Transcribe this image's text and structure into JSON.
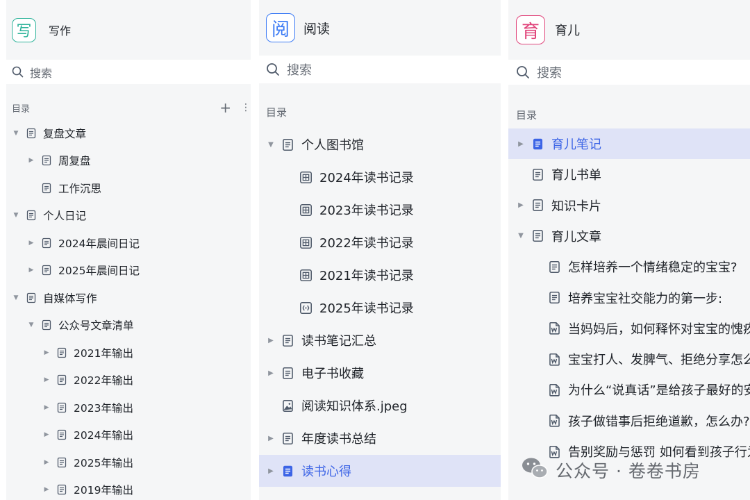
{
  "colors": {
    "panel_bg": "#f5f6f7",
    "active_bg": "#dfe3f7",
    "active_text": "#3c64e6",
    "write_accent": "#2eb39a",
    "read_accent": "#3c7bf5",
    "parent_accent": "#e0457b"
  },
  "panel1": {
    "icon_char": "写",
    "title": "写作",
    "search_label": "搜索",
    "toc_label": "目录",
    "add_glyph": "+",
    "items": [
      {
        "label": "复盘文章",
        "icon": "doc-icon",
        "arrow": "expanded"
      },
      {
        "label": "周复盘",
        "icon": "doc-icon",
        "arrow": "collapsed"
      },
      {
        "label": "工作沉思",
        "icon": "doc-icon",
        "arrow": "none"
      },
      {
        "label": "个人日记",
        "icon": "doc-icon",
        "arrow": "expanded"
      },
      {
        "label": "2024年晨间日记",
        "icon": "doc-icon",
        "arrow": "collapsed"
      },
      {
        "label": "2025年晨间日记",
        "icon": "doc-icon",
        "arrow": "collapsed"
      },
      {
        "label": "自媒体写作",
        "icon": "doc-icon",
        "arrow": "expanded"
      },
      {
        "label": "公众号文章清单",
        "icon": "doc-icon",
        "arrow": "expanded"
      },
      {
        "label": "2021年输出",
        "icon": "doc-icon",
        "arrow": "collapsed"
      },
      {
        "label": "2022年输出",
        "icon": "doc-icon",
        "arrow": "collapsed"
      },
      {
        "label": "2023年输出",
        "icon": "doc-icon",
        "arrow": "collapsed"
      },
      {
        "label": "2024年输出",
        "icon": "doc-icon",
        "arrow": "collapsed"
      },
      {
        "label": "2025年输出",
        "icon": "doc-icon",
        "arrow": "collapsed"
      },
      {
        "label": "2019年输出",
        "icon": "doc-icon",
        "arrow": "collapsed"
      }
    ]
  },
  "panel2": {
    "icon_char": "阅",
    "title": "阅读",
    "search_label": "搜索",
    "toc_label": "目录",
    "items": [
      {
        "label": "个人图书馆",
        "icon": "doc-icon",
        "arrow": "expanded"
      },
      {
        "label": "2024年读书记录",
        "icon": "table-icon",
        "arrow": "none"
      },
      {
        "label": "2023年读书记录",
        "icon": "table-icon",
        "arrow": "none"
      },
      {
        "label": "2022年读书记录",
        "icon": "table-icon",
        "arrow": "none"
      },
      {
        "label": "2021年读书记录",
        "icon": "table-icon",
        "arrow": "none"
      },
      {
        "label": "2025年读书记录",
        "icon": "embed-icon",
        "arrow": "none"
      },
      {
        "label": "读书笔记汇总",
        "icon": "doc-icon",
        "arrow": "collapsed"
      },
      {
        "label": "电子书收藏",
        "icon": "doc-icon",
        "arrow": "collapsed"
      },
      {
        "label": "阅读知识体系.jpeg",
        "icon": "image-icon",
        "arrow": "none"
      },
      {
        "label": "年度读书总结",
        "icon": "doc-icon",
        "arrow": "collapsed"
      },
      {
        "label": "读书心得",
        "icon": "doc-filled-icon",
        "arrow": "collapsed",
        "active": true
      }
    ]
  },
  "panel3": {
    "icon_char": "育",
    "title": "育儿",
    "search_label": "搜索",
    "toc_label": "目录",
    "items": [
      {
        "label": "育儿笔记",
        "icon": "doc-filled-icon",
        "arrow": "collapsed",
        "active": true
      },
      {
        "label": "育儿书单",
        "icon": "doc-icon",
        "arrow": "none"
      },
      {
        "label": "知识卡片",
        "icon": "doc-icon",
        "arrow": "collapsed"
      },
      {
        "label": "育儿文章",
        "icon": "doc-icon",
        "arrow": "expanded"
      },
      {
        "label": "怎样培养一个情绪稳定的宝宝?",
        "icon": "doc-icon",
        "arrow": "none"
      },
      {
        "label": "培养宝宝社交能力的第一步:",
        "icon": "doc-icon",
        "arrow": "none"
      },
      {
        "label": "当妈妈后，如何释怀对宝宝的愧疚感",
        "icon": "word-icon",
        "arrow": "none"
      },
      {
        "label": "宝宝打人、发脾气、拒绝分享怎么办",
        "icon": "word-icon",
        "arrow": "none"
      },
      {
        "label": "为什么“说真话”是给孩子最好的安全感",
        "icon": "word-icon",
        "arrow": "none"
      },
      {
        "label": "孩子做错事后拒绝道歉，怎么办?",
        "icon": "word-icon",
        "arrow": "none"
      },
      {
        "label": "告别奖励与惩罚 如何看到孩子行为背后",
        "icon": "word-icon",
        "arrow": "none"
      }
    ]
  },
  "watermark": {
    "text": "公众号 · 卷卷书房",
    "logo": "wechat-logo"
  }
}
